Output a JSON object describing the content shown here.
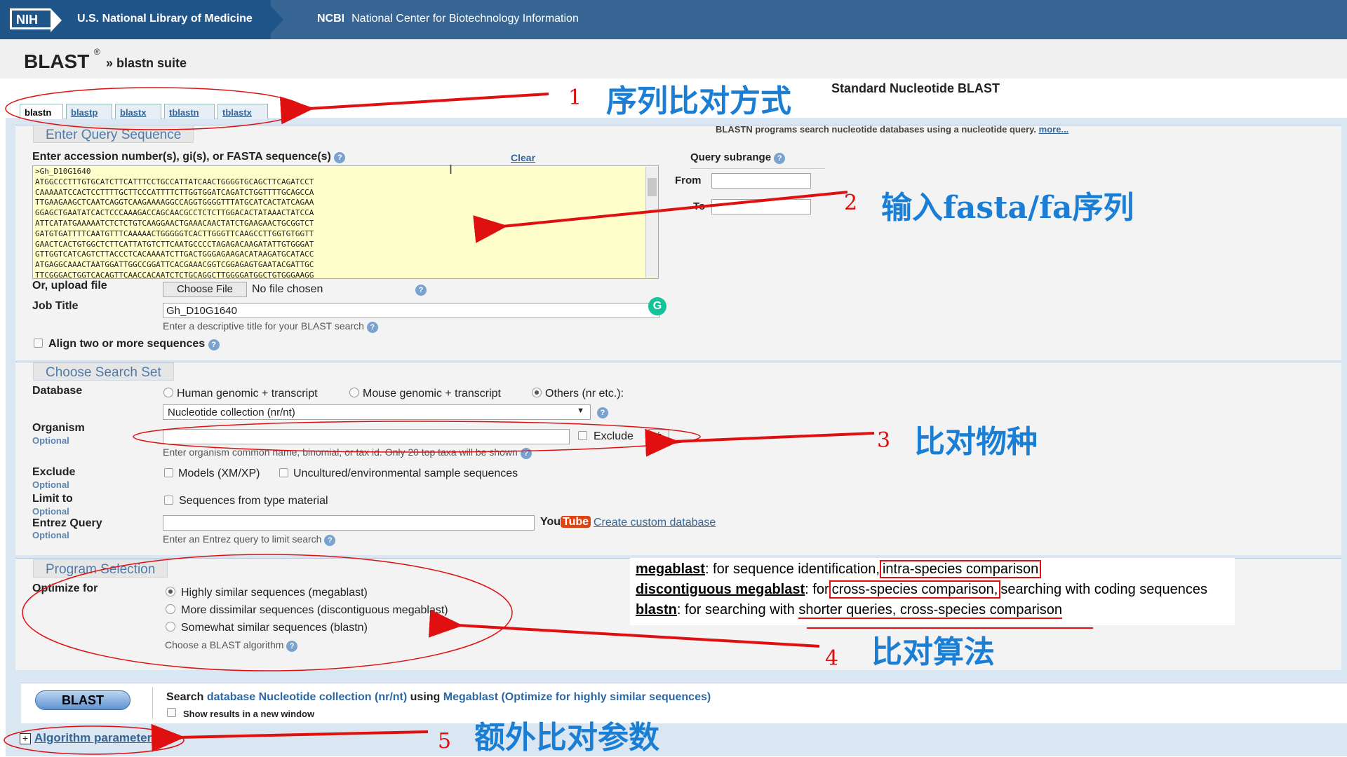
{
  "header": {
    "nih_logo": "NIH",
    "nlm_text": "U.S. National Library of Medicine",
    "ncbi_abbr": "NCBI",
    "ncbi_text": "National Center for Biotechnology Information"
  },
  "page": {
    "title": "BLAST",
    "registered": "®",
    "breadcrumb": "» blastn suite",
    "subtitle": "Standard Nucleotide BLAST"
  },
  "tabs": [
    {
      "label": "blastn",
      "active": true
    },
    {
      "label": "blastp"
    },
    {
      "label": "blastx"
    },
    {
      "label": "tblastn"
    },
    {
      "label": "tblastx"
    }
  ],
  "query": {
    "section_title": "Enter Query Sequence",
    "description": "BLASTN programs search nucleotide databases using a nucleotide query.",
    "more_link": "more...",
    "input_label": "Enter accession number(s), gi(s), or FASTA sequence(s)",
    "clear_link": "Clear",
    "sequence_lines": [
      ">Gh_D10G1640",
      "ATGGCCCTTTGTGCATCTTCATTTCCTGCCATTATCAACTGGGGTGCAGCTTCAGATCCT",
      "CAAAAATCCACTCCTTTTGCTTCCCATTTTCTTGGTGGATCAGATCTGGTTTTGCAGCCA",
      "TTGAAGAAGCTCAATCAGGTCAAGAAAAGGCCAGGTGGGGTTTATGCATCACTATCAGAA",
      "GGAGCTGAATATCACTCCCAAAGACCAGCAACGCCTCTCTTGGACACTATAAACTATCCA",
      "ATTCATATGAAAAATCTCTCTGTCAAGGAACTGAAACAACTATCTGAAGAACTGCGGTCT",
      "GATGTGATTTTCAATGTTTCAAAAACTGGGGGTCACTTGGGTTCAAGCCTTGGTGTGGTT",
      "GAACTCACTGTGGCTCTTCATTATGTCTTCAATGCCCCTAGAGACAAGATATTGTGGGAT",
      "GTTGGTCATCAGTCTTACCCTCACAAAATCTTGACTGGGAGAAGACATAAGATGCATACC",
      "ATGAGGCAAACTAATGGATTGGCCGGATTCACGAAACGGTCGGAGAGTGAATACGATTGC",
      "TTCGGGACTGGTCACAGTTCAACCACAATCTCTGCAGGCTTGGGGATGGCTGTGGGAAGG"
    ],
    "subrange_label": "Query subrange",
    "from_label": "From",
    "to_label": "To",
    "from_value": "",
    "to_value": "",
    "upload_label": "Or, upload file",
    "choose_file": "Choose File",
    "no_file": "No file chosen",
    "job_title_label": "Job Title",
    "job_title_value": "Gh_D10G1640",
    "job_title_hint": "Enter a descriptive title for your BLAST search",
    "align_two": "Align two or more sequences"
  },
  "search_set": {
    "section_title": "Choose Search Set",
    "database_label": "Database",
    "db_options": [
      "Human genomic + transcript",
      "Mouse genomic + transcript",
      "Others (nr etc.):"
    ],
    "db_selected": "Nucleotide collection (nr/nt)",
    "organism_label": "Organism",
    "optional": "Optional",
    "organism_value": "",
    "exclude_label": "Exclude",
    "plus": "+",
    "organism_hint": "Enter organism common name, binomial, or tax id. Only 20 top taxa will be shown",
    "exclude_section_label": "Exclude",
    "exclude_models": "Models (XM/XP)",
    "exclude_uncultured": "Uncultured/environmental sample sequences",
    "limit_label": "Limit to",
    "limit_type": "Sequences from type material",
    "entrez_label": "Entrez Query",
    "entrez_value": "",
    "youtube_you": "You",
    "youtube_tube": "Tube",
    "custom_db": "Create custom database",
    "entrez_hint": "Enter an Entrez query to limit search"
  },
  "program": {
    "section_title": "Program Selection",
    "optimize_label": "Optimize for",
    "options": [
      {
        "label": "Highly similar sequences (megablast)",
        "selected": true
      },
      {
        "label": "More dissimilar sequences (discontiguous megablast)"
      },
      {
        "label": "Somewhat similar sequences (blastn)"
      }
    ],
    "choose_hint": "Choose a BLAST algorithm"
  },
  "submit": {
    "button": "BLAST",
    "summary_prefix": "Search",
    "summary_db": "database Nucleotide collection (nr/nt)",
    "summary_using": "using",
    "summary_algo": "Megablast (Optimize for highly similar sequences)",
    "new_window": "Show results in a new window",
    "algo_params": "Algorithm parameters"
  },
  "annotations": [
    {
      "num": "1",
      "text": "序列比对方式"
    },
    {
      "num": "2",
      "text": "输入fasta/fa序列"
    },
    {
      "num": "3",
      "text": "比对物种"
    },
    {
      "num": "4",
      "text": "比对算法"
    },
    {
      "num": "5",
      "text": "额外比对参数"
    }
  ],
  "explanation": {
    "l1_term": "megablast",
    "l1_text": ": for sequence identification,",
    "l1_box": "intra-species comparison",
    "l2_term": "discontiguous megablast",
    "l2_text": ": for",
    "l2_box": "cross-species comparison,",
    "l2_tail": "searching with coding sequences",
    "l3_term": "blastn",
    "l3_text": ": for searching with",
    "l3_underlined": "shorter queries, cross-species comparison"
  },
  "colors": {
    "header_blue": "#20558a",
    "annotation_red": "#e01010",
    "annotation_blue": "#1a7fd4",
    "fasta_bg": "#ffffcc"
  }
}
